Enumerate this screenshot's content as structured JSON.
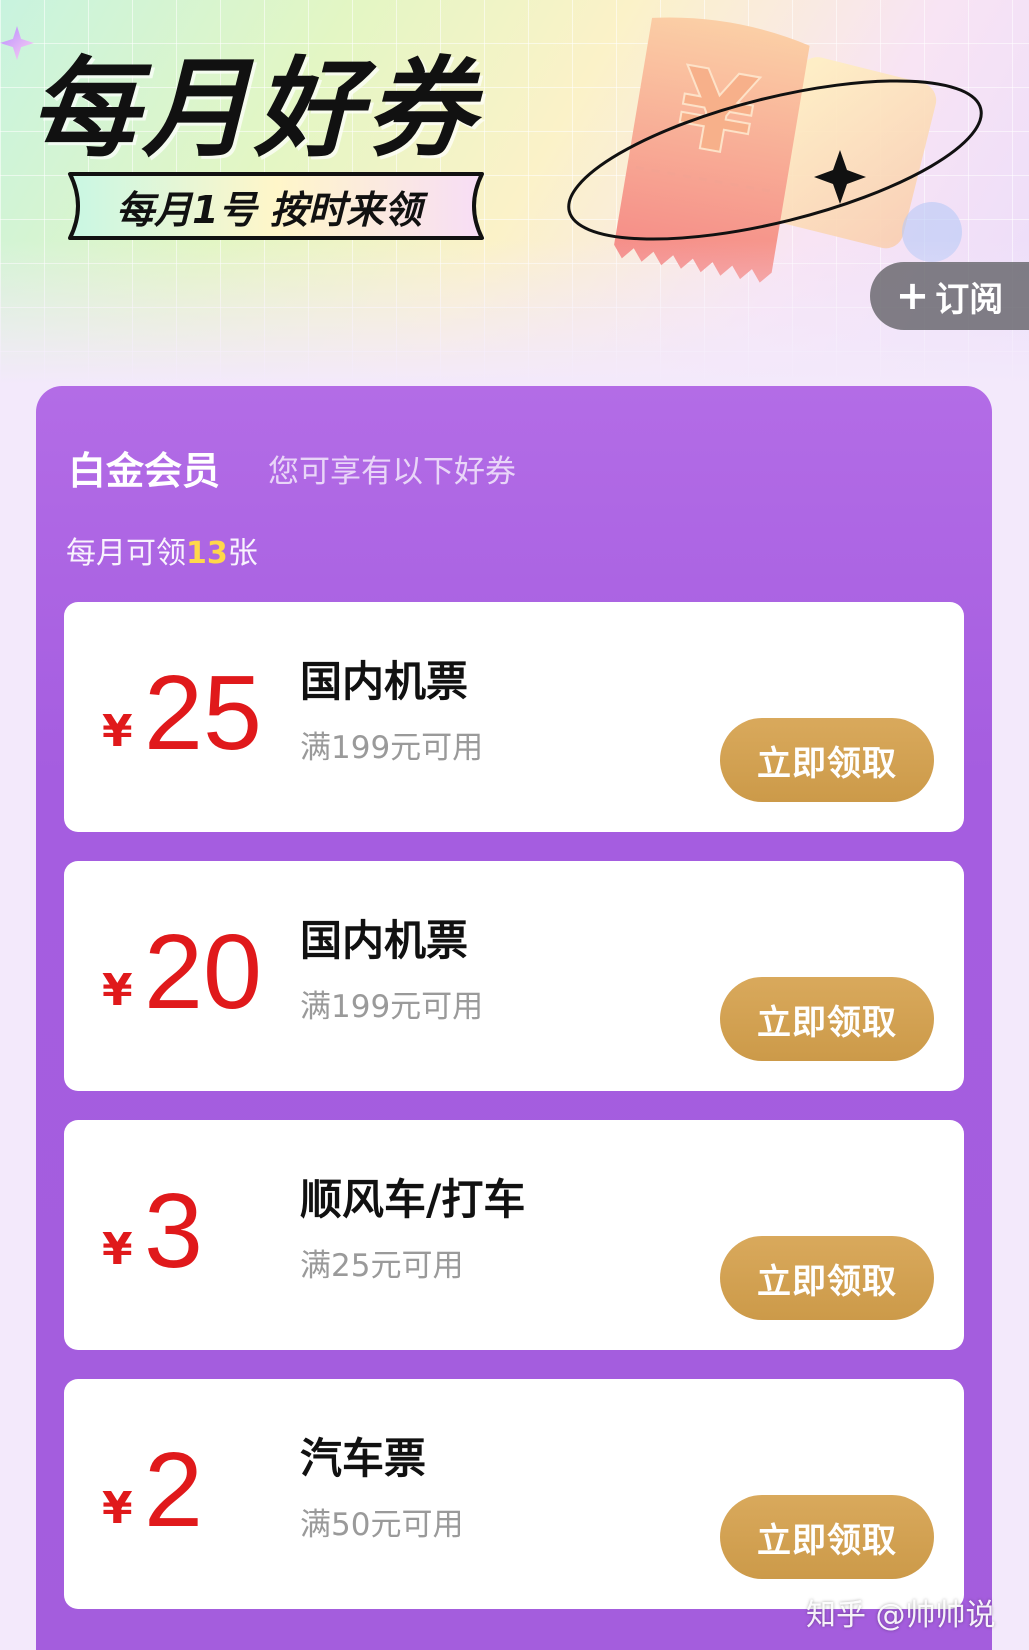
{
  "header": {
    "title": "每月好券",
    "subtitle": "每月1号 按时来领",
    "subscribe_label": "订阅",
    "subscribe_icon": "plus-icon"
  },
  "panel": {
    "tier_title": "白金会员",
    "tier_desc": "您可享有以下好券",
    "monthly_prefix": "每月可领",
    "monthly_count": "13",
    "monthly_suffix": "张"
  },
  "coupons": [
    {
      "currency": "¥",
      "amount": "25",
      "name": "国内机票",
      "condition": "满199元可用",
      "button": "立即领取"
    },
    {
      "currency": "¥",
      "amount": "20",
      "name": "国内机票",
      "condition": "满199元可用",
      "button": "立即领取"
    },
    {
      "currency": "¥",
      "amount": "3",
      "name": "顺风车/打车",
      "condition": "满25元可用",
      "button": "立即领取"
    },
    {
      "currency": "¥",
      "amount": "2",
      "name": "汽车票",
      "condition": "满50元可用",
      "button": "立即领取"
    }
  ],
  "watermark": "知乎 @帅帅说",
  "colors": {
    "panel": "#a55de0",
    "price": "#e0191b",
    "claim_button": "#d3a252",
    "highlight": "#ffd84a"
  }
}
